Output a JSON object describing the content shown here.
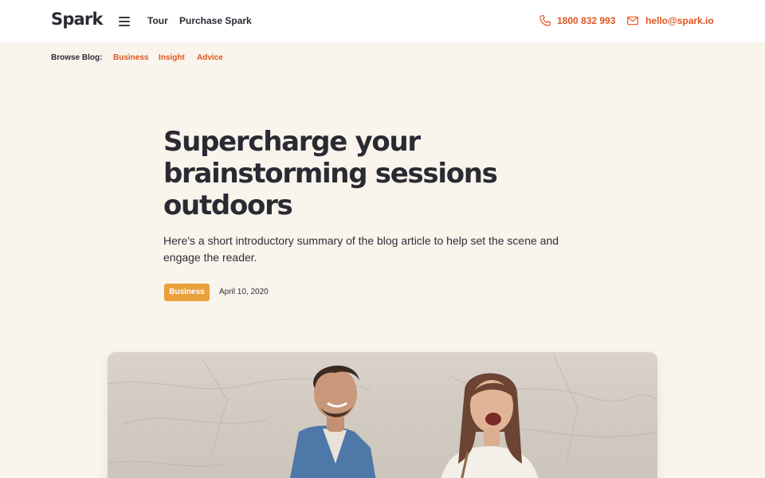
{
  "header": {
    "logo": "Spark",
    "nav": [
      {
        "label": "Tour"
      },
      {
        "label": "Purchase Spark"
      }
    ],
    "phone": "1800 832 993",
    "email": "hello@spark.io"
  },
  "subnav": {
    "label": "Browse Blog:",
    "categories": [
      "Business",
      "Insight",
      "Advice"
    ]
  },
  "article": {
    "title_lines": [
      "Supercharge your",
      "brainstorming sessions",
      "outdoors"
    ],
    "summary_lines": [
      "Here's a short introductory summary of the blog article to help set the scene and",
      "engage the reader."
    ],
    "category": "Business",
    "date": "April 10, 2020"
  },
  "colors": {
    "accent": "#e0551f",
    "badge": "#e9a13b",
    "background": "#f9f4ec",
    "text": "#2a2a33"
  },
  "icons": {
    "menu": "hamburger-menu-icon",
    "phone": "phone-icon",
    "email": "envelope-icon"
  }
}
